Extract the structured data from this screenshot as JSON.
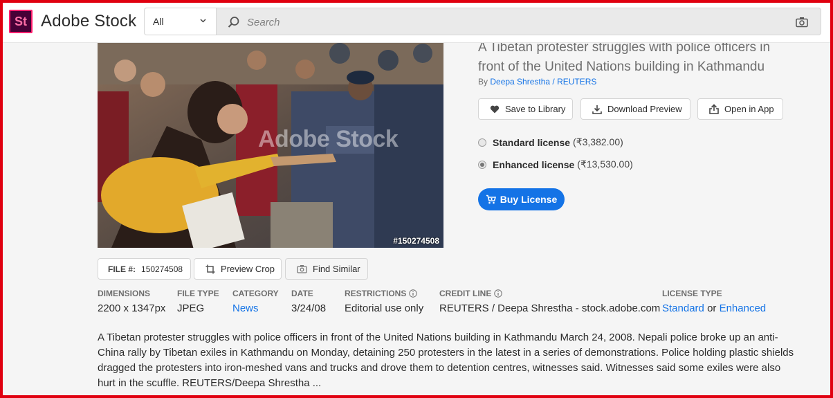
{
  "header": {
    "logo_badge": "St",
    "logo_text": "Adobe Stock",
    "filter_value": "All",
    "search_placeholder": "Search"
  },
  "asset": {
    "watermark": "Adobe Stock",
    "tag": "#150274508",
    "title": "A Tibetan protester struggles with police officers in front of the United Nations building in Kathmandu",
    "by_prefix": "By",
    "author": "Deepa Shrestha / REUTERS"
  },
  "actions": {
    "save": "Save to Library",
    "download": "Download Preview",
    "open_app": "Open in App"
  },
  "licenses": {
    "standard_label": "Standard license",
    "standard_price": "(₹3,382.00)",
    "enhanced_label": "Enhanced license",
    "enhanced_price": "(₹13,530.00)",
    "selected": "enhanced"
  },
  "buy_label": "Buy License",
  "file": {
    "label": "FILE #:",
    "number": "150274508",
    "preview_crop": "Preview Crop",
    "find_similar": "Find Similar"
  },
  "meta": {
    "dimensions_label": "DIMENSIONS",
    "dimensions": "2200 x 1347px",
    "filetype_label": "FILE TYPE",
    "filetype": "JPEG",
    "category_label": "CATEGORY",
    "category": "News",
    "date_label": "DATE",
    "date": "3/24/08",
    "restrictions_label": "RESTRICTIONS",
    "restrictions": "Editorial use only",
    "credit_label": "CREDIT LINE",
    "credit": "REUTERS / Deepa Shrestha - stock.adobe.com",
    "license_label": "LICENSE TYPE",
    "license_standard": "Standard",
    "license_or": "or",
    "license_enhanced": "Enhanced"
  },
  "description": "A Tibetan protester struggles with police officers in front of the United Nations building in Kathmandu March 24, 2008. Nepali police broke up an anti-China rally by Tibetan exiles in Kathmandu on Monday, detaining 250 protesters in the latest in a series of demonstrations. Police holding plastic shields dragged the protesters into iron-meshed vans and trucks and drove them to detention centres, witnesses said. Witnesses said some exiles were also hurt in the scuffle. REUTERS/Deepa Shrestha ...",
  "colors": {
    "accent": "#1473e6",
    "logo_bg": "#470137",
    "logo_fg": "#ff1e6d",
    "frame": "#e0000f"
  }
}
